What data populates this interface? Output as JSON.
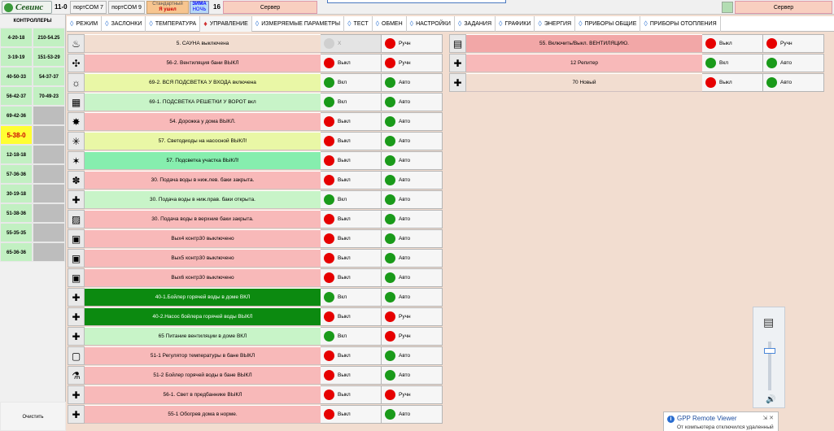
{
  "topbar": {
    "logo_text": "Севинс",
    "code": "11-0",
    "port1": "портCOM 7",
    "port2": "портCOM 9",
    "mode_line1": "Стандартный",
    "mode_line2": "Я ушел",
    "season_line1": "ЗИМА",
    "season_line2": "НОЧЬ",
    "number": "16",
    "server_left": "Сервер",
    "server_right": "Сервер"
  },
  "left": {
    "title": "КОНТРОЛЛЕРЫ",
    "cells": [
      [
        "4-20-18",
        "210-54.25"
      ],
      [
        "3-19-19",
        "151-53-29"
      ],
      [
        "40-50-33",
        "54-37-37"
      ],
      [
        "56-42-37",
        "70-49-23"
      ],
      [
        "69-42-36",
        ""
      ],
      [
        "5-38-0",
        ""
      ],
      [
        "12-18-18",
        ""
      ],
      [
        "57-36-36",
        ""
      ],
      [
        "30-19-18",
        ""
      ],
      [
        "51-38-36",
        ""
      ],
      [
        "55-35-35",
        ""
      ],
      [
        "65-36-36",
        ""
      ]
    ],
    "clear_label": "Очистить"
  },
  "tabs": [
    {
      "label": "РЕЖИМ",
      "active": false
    },
    {
      "label": "ЗАСЛОНКИ",
      "active": false
    },
    {
      "label": "ТЕМПЕРАТУРА",
      "active": false
    },
    {
      "label": "УПРАВЛЕНИЕ",
      "active": true
    },
    {
      "label": "ИЗМЕРЯЕМЫЕ ПАРАМЕТРЫ",
      "active": false
    },
    {
      "label": "ТЕСТ",
      "active": false
    },
    {
      "label": "ОБМЕН",
      "active": false
    },
    {
      "label": "НАСТРОЙКИ",
      "active": false
    },
    {
      "label": "ЗАДАНИЯ",
      "active": false
    },
    {
      "label": "ГРАФИКИ",
      "active": false
    },
    {
      "label": "ЭНЕРГИЯ",
      "active": false
    },
    {
      "label": "ПРИБОРЫ ОБЩИЕ",
      "active": false
    },
    {
      "label": "ПРИБОРЫ ОТОПЛЕНИЯ",
      "active": false
    }
  ],
  "rows_left": [
    {
      "text": "5. САУНА выключена",
      "color": "pink",
      "icon": "sauna-icon",
      "s1": "Х",
      "s1c": "gray",
      "s2": "Ручн",
      "s2c": "red"
    },
    {
      "text": "56-2. Вентиляция бани ВЫКЛ",
      "color": "red",
      "icon": "fan-icon",
      "s1": "Выкл",
      "s1c": "red",
      "s2": "Ручн",
      "s2c": "red"
    },
    {
      "text": "69-2. ВСЯ ПОДСВЕТКА У ВХОДА включена",
      "color": "yellow",
      "icon": "bulb-icon",
      "s1": "Вкл",
      "s1c": "green",
      "s2": "Авто",
      "s2c": "green"
    },
    {
      "text": "69-1. ПОДСВЕТКА РЕШЕТКИ У ВОРОТ вкл",
      "color": "green",
      "icon": "gate-icon",
      "s1": "Вкл",
      "s1c": "green",
      "s2": "Авто",
      "s2c": "green"
    },
    {
      "text": "54. Дорожка у дома ВЫКЛ.",
      "color": "red",
      "icon": "path-light-icon",
      "s1": "Выкл",
      "s1c": "red",
      "s2": "Авто",
      "s2c": "green"
    },
    {
      "text": "57. Светодиоды на насосной ВЫКЛ!",
      "color": "yellow",
      "icon": "led-icon",
      "s1": "Выкл",
      "s1c": "red",
      "s2": "Авто",
      "s2c": "green"
    },
    {
      "text": "57. Подсветка участка ВЫКЛ!",
      "color": "mint",
      "icon": "lamp-icon",
      "s1": "Выкл",
      "s1c": "red",
      "s2": "Авто",
      "s2c": "green"
    },
    {
      "text": "30. Подача воды в ниж.лев. баки закрыта.",
      "color": "red",
      "icon": "water-icon",
      "s1": "Выкл",
      "s1c": "red",
      "s2": "Авто",
      "s2c": "green"
    },
    {
      "text": "30. Подача воды в ниж.прав. баки открыта.",
      "color": "green",
      "icon": "valve-icon",
      "s1": "Вкл",
      "s1c": "green",
      "s2": "Авто",
      "s2c": "green"
    },
    {
      "text": "30. Подача воды в верхние баки закрыта.",
      "color": "red",
      "icon": "tank-icon",
      "s1": "Выкл",
      "s1c": "red",
      "s2": "Авто",
      "s2c": "green"
    },
    {
      "text": "Вых4 контр30 выключено",
      "color": "red",
      "icon": "output-icon",
      "s1": "Выкл",
      "s1c": "red",
      "s2": "Авто",
      "s2c": "green"
    },
    {
      "text": "Вых5 контр30 выключено",
      "color": "red",
      "icon": "output-icon",
      "s1": "Выкл",
      "s1c": "red",
      "s2": "Авто",
      "s2c": "green"
    },
    {
      "text": "Вых6 контр30 выключено",
      "color": "red",
      "icon": "output-icon",
      "s1": "Выкл",
      "s1c": "red",
      "s2": "Авто",
      "s2c": "green"
    },
    {
      "text": "40-1.Бойлер горячей воды в доме ВКЛ",
      "color": "dgreen",
      "icon": "valve-icon",
      "s1": "Вкл",
      "s1c": "green",
      "s2": "Авто",
      "s2c": "green"
    },
    {
      "text": "40-2.Насос бойлера горячей воды ВЫКЛ",
      "color": "dgreen",
      "icon": "valve-icon",
      "s1": "Выкл",
      "s1c": "red",
      "s2": "Ручн",
      "s2c": "red"
    },
    {
      "text": "65 Питание вентиляции в доме ВКЛ",
      "color": "green",
      "icon": "valve-icon",
      "s1": "Вкл",
      "s1c": "green",
      "s2": "Ручн",
      "s2c": "red"
    },
    {
      "text": "51-1 Регулятор температуры в бане ВЫКЛ",
      "color": "red",
      "icon": "monitor-icon",
      "s1": "Выкл",
      "s1c": "red",
      "s2": "Авто",
      "s2c": "green"
    },
    {
      "text": "51-2 Бойлер горячей воды в бане ВЫКЛ",
      "color": "red",
      "icon": "boiler-icon",
      "s1": "Выкл",
      "s1c": "red",
      "s2": "Авто",
      "s2c": "green"
    },
    {
      "text": "56-1. Свет в предбаннике ВЫКЛ",
      "color": "red",
      "icon": "valve-icon",
      "s1": "Выкл",
      "s1c": "red",
      "s2": "Ручн",
      "s2c": "red"
    },
    {
      "text": "55-1 Обогрев дома в норме.",
      "color": "red",
      "icon": "valve-icon",
      "s1": "Выкл",
      "s1c": "red",
      "s2": "Авто",
      "s2c": "green"
    }
  ],
  "rows_right": [
    {
      "text": "55. Включить/Выкл. ВЕНТИЛЯЦИЮ.",
      "color": "salmon",
      "icon": "device-icon",
      "s1": "Выкл",
      "s1c": "red",
      "s2": "Ручн",
      "s2c": "red"
    },
    {
      "text": "12 Репитер",
      "color": "red",
      "icon": "valve-icon",
      "s1": "Вкл",
      "s1c": "green",
      "s2": "Авто",
      "s2c": "green"
    },
    {
      "text": "70 Новый",
      "color": "pink",
      "icon": "valve-icon",
      "s1": "Выкл",
      "s1c": "red",
      "s2": "Авто",
      "s2c": "green"
    }
  ],
  "toast": {
    "title": "GPP Remote Viewer",
    "message": "От компьютера отключился удаленный"
  }
}
